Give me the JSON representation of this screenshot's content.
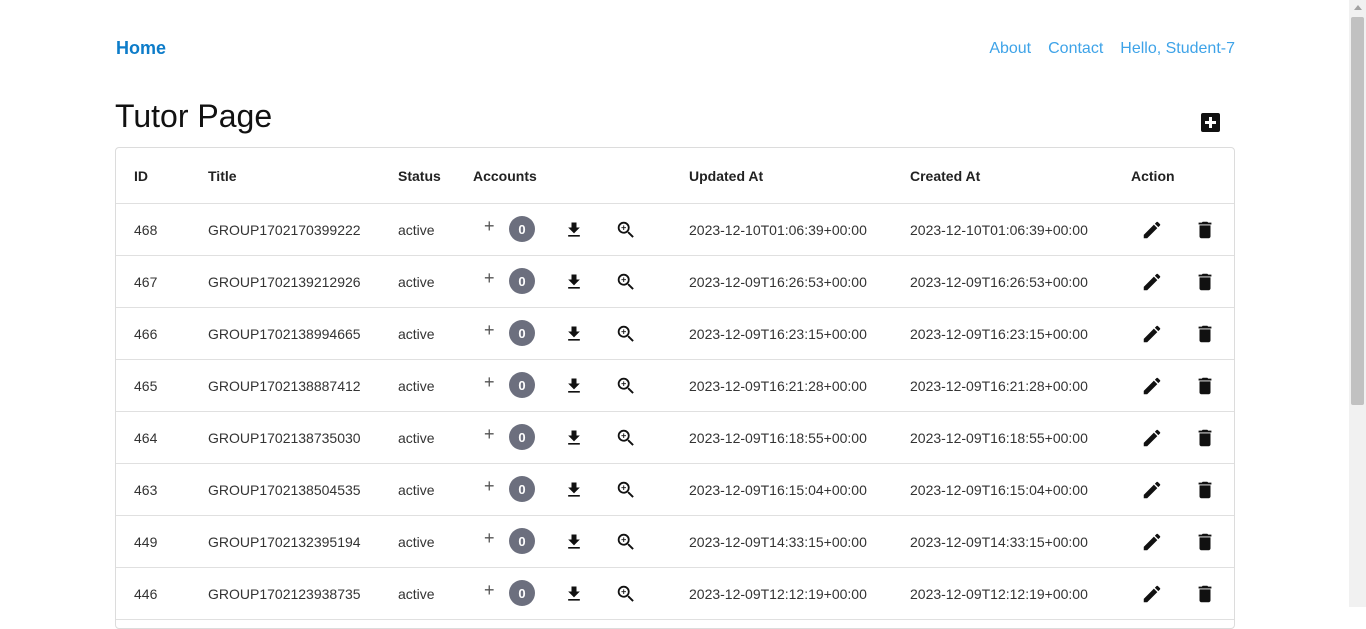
{
  "nav": {
    "brand": "Home",
    "links": [
      "About",
      "Contact",
      "Hello, Student-7"
    ]
  },
  "page": {
    "title": "Tutor Page"
  },
  "table": {
    "headers": [
      "ID",
      "Title",
      "Status",
      "Accounts",
      "Updated At",
      "Created At",
      "Action"
    ],
    "rows": [
      {
        "id": "468",
        "title": "GROUP1702170399222",
        "status": "active",
        "accounts": "0",
        "updated": "2023-12-10T01:06:39+00:00",
        "created": "2023-12-10T01:06:39+00:00"
      },
      {
        "id": "467",
        "title": "GROUP1702139212926",
        "status": "active",
        "accounts": "0",
        "updated": "2023-12-09T16:26:53+00:00",
        "created": "2023-12-09T16:26:53+00:00"
      },
      {
        "id": "466",
        "title": "GROUP1702138994665",
        "status": "active",
        "accounts": "0",
        "updated": "2023-12-09T16:23:15+00:00",
        "created": "2023-12-09T16:23:15+00:00"
      },
      {
        "id": "465",
        "title": "GROUP1702138887412",
        "status": "active",
        "accounts": "0",
        "updated": "2023-12-09T16:21:28+00:00",
        "created": "2023-12-09T16:21:28+00:00"
      },
      {
        "id": "464",
        "title": "GROUP1702138735030",
        "status": "active",
        "accounts": "0",
        "updated": "2023-12-09T16:18:55+00:00",
        "created": "2023-12-09T16:18:55+00:00"
      },
      {
        "id": "463",
        "title": "GROUP1702138504535",
        "status": "active",
        "accounts": "0",
        "updated": "2023-12-09T16:15:04+00:00",
        "created": "2023-12-09T16:15:04+00:00"
      },
      {
        "id": "449",
        "title": "GROUP1702132395194",
        "status": "active",
        "accounts": "0",
        "updated": "2023-12-09T14:33:15+00:00",
        "created": "2023-12-09T14:33:15+00:00"
      },
      {
        "id": "446",
        "title": "GROUP1702123938735",
        "status": "active",
        "accounts": "0",
        "updated": "2023-12-09T12:12:19+00:00",
        "created": "2023-12-09T12:12:19+00:00"
      }
    ]
  },
  "icons": {
    "add_group": "add-box-icon",
    "account_add": "plus-icon",
    "download": "download-icon",
    "view": "zoom-in-icon",
    "edit": "pencil-icon",
    "delete": "trash-icon"
  }
}
